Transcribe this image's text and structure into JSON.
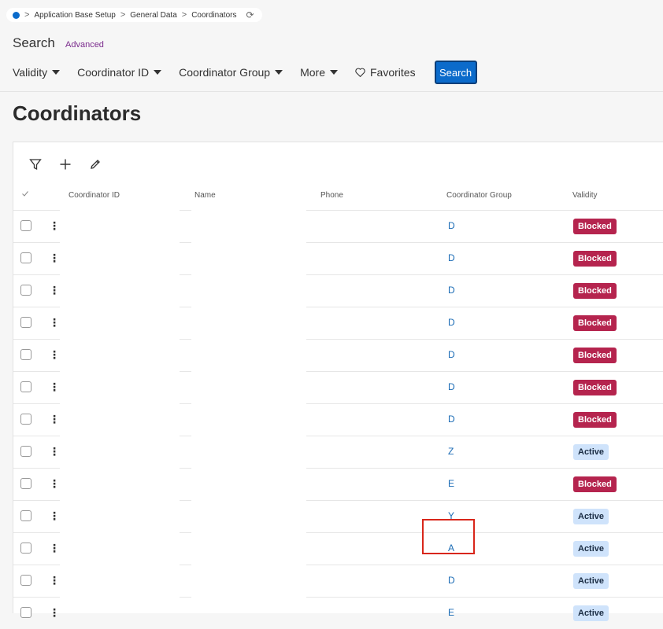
{
  "breadcrumb": {
    "items": [
      "Application Base Setup",
      "General Data",
      "Coordinators"
    ],
    "separator": ">"
  },
  "search": {
    "title": "Search",
    "advanced_label": "Advanced",
    "filters": [
      "Validity",
      "Coordinator ID",
      "Coordinator Group",
      "More"
    ],
    "favorites_label": "Favorites",
    "button_label": "Search"
  },
  "page": {
    "title": "Coordinators"
  },
  "table": {
    "columns": {
      "coordinator_id": "Coordinator ID",
      "name": "Name",
      "phone": "Phone",
      "coordinator_group": "Coordinator Group",
      "validity": "Validity"
    },
    "rows": [
      {
        "group": "D",
        "validity": "Blocked"
      },
      {
        "group": "D",
        "validity": "Blocked"
      },
      {
        "group": "D",
        "validity": "Blocked"
      },
      {
        "group": "D",
        "validity": "Blocked"
      },
      {
        "group": "D",
        "validity": "Blocked"
      },
      {
        "group": "D",
        "validity": "Blocked"
      },
      {
        "group": "D",
        "validity": "Blocked"
      },
      {
        "group": "Z",
        "validity": "Active"
      },
      {
        "group": "E",
        "validity": "Blocked"
      },
      {
        "group": "Y",
        "validity": "Active"
      },
      {
        "group": "A",
        "validity": "Active"
      },
      {
        "group": "D",
        "validity": "Active"
      },
      {
        "group": "E",
        "validity": "Active"
      }
    ]
  },
  "colors": {
    "accent": "#0b6bcb",
    "blocked": "#b5244e",
    "active": "#cfe3fb",
    "highlight": "#d8261a"
  }
}
